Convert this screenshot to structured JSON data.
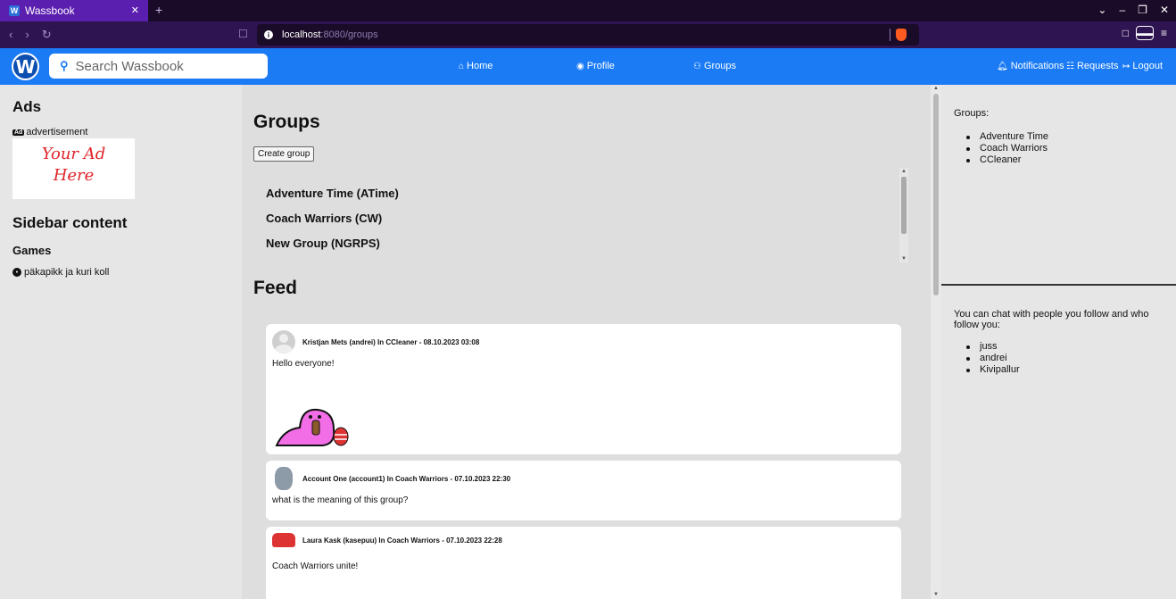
{
  "browser": {
    "tab_title": "Wassbook",
    "tab_close": "✕",
    "new_tab": "+",
    "url_host": "localhost",
    "url_path": ":8080/groups",
    "window_controls": [
      "⌄",
      "–",
      "❐",
      "✕"
    ]
  },
  "nav": {
    "logo_letter": "W",
    "search_placeholder": "Search Wassbook",
    "links": {
      "home": "Home",
      "profile": "Profile",
      "groups": "Groups",
      "notifications": "Notifications",
      "requests": "Requests",
      "logout": "Logout"
    }
  },
  "left": {
    "ads_title": "Ads",
    "ad_icon": "Ad",
    "ad_label": "advertisement",
    "ad_line1": "Your Ad",
    "ad_line2": "Here",
    "sidebar_title": "Sidebar content",
    "games_title": "Games",
    "game_item": "päkapikk ja kuri koll"
  },
  "main": {
    "groups_title": "Groups",
    "create_group_label": "Create group",
    "groups": [
      "Adventure Time (ATime)",
      "Coach Warriors (CW)",
      "New Group (NGRPS)"
    ],
    "feed_title": "Feed",
    "posts": [
      {
        "meta": "Kristjan Mets (andrei) In CCleaner - 08.10.2023 03:08",
        "text": "Hello everyone!"
      },
      {
        "meta": "Account One (account1) In Coach Warriors - 07.10.2023 22:30",
        "text": "what is the meaning of this group?"
      },
      {
        "meta": "Laura Kask (kasepuu) In Coach Warriors - 07.10.2023 22:28",
        "text": "Coach Warriors unite!"
      }
    ]
  },
  "right": {
    "groups_label": "Groups:",
    "groups": [
      "Adventure Time",
      "Coach Warriors",
      "CCleaner"
    ],
    "chat_label": "You can chat with people you follow and who follow you:",
    "chat_users": [
      "juss",
      "andrei",
      "Kivipallur"
    ]
  },
  "colors": {
    "nav_blue": "#1a7bf5",
    "browser_purple": "#5b1fb0",
    "ad_red": "#e0242a"
  }
}
